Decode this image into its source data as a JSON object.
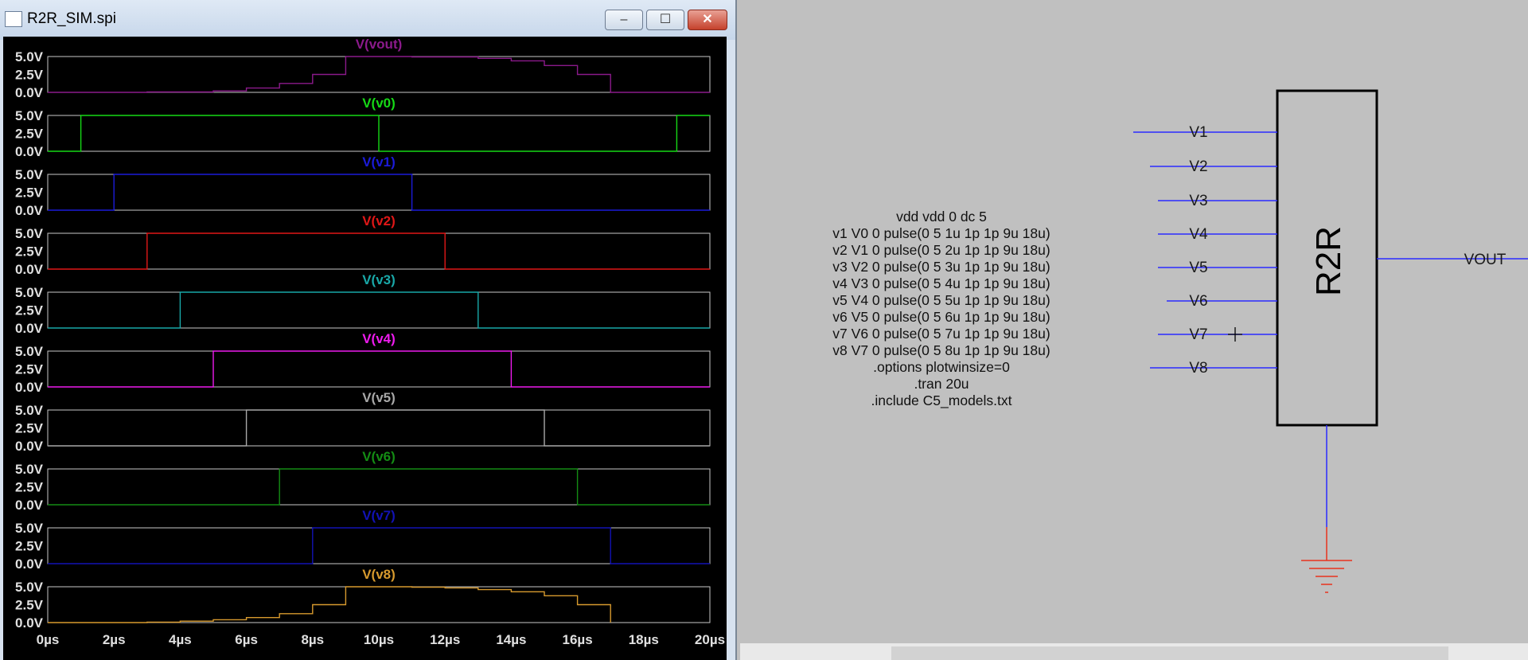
{
  "window": {
    "title": "R2R_SIM.spi",
    "buttons": {
      "minimize": "–",
      "maximize": "☐",
      "close": "✕"
    }
  },
  "colors": {
    "vout": "#8b1a8b",
    "v0": "#16d916",
    "v1": "#1b1bd9",
    "v2": "#e01717",
    "v3": "#19a8a8",
    "v4": "#ee1bee",
    "v5": "#a8a8a8",
    "v6": "#148c14",
    "v7": "#1212b4",
    "v8": "#d79a2e",
    "wire": "#2a2aff",
    "ground": "#e8321e"
  },
  "chart_data": {
    "type": "line",
    "xlabel": "",
    "x_ticks": [
      "0µs",
      "2µs",
      "4µs",
      "6µs",
      "8µs",
      "10µs",
      "12µs",
      "14µs",
      "16µs",
      "18µs",
      "20µs"
    ],
    "xlim": [
      0,
      20
    ],
    "y_ticks": [
      "5.0V",
      "2.5V",
      "0.0V"
    ],
    "ylim": [
      0,
      5
    ],
    "panels": [
      {
        "name": "V(vout)",
        "color_key": "vout",
        "points": [
          [
            0,
            0
          ],
          [
            3,
            0
          ],
          [
            3,
            0.05
          ],
          [
            5,
            0.05
          ],
          [
            5,
            0.2
          ],
          [
            6,
            0.2
          ],
          [
            6,
            0.6
          ],
          [
            7,
            0.6
          ],
          [
            7,
            1.25
          ],
          [
            8,
            1.25
          ],
          [
            8,
            2.5
          ],
          [
            9,
            2.5
          ],
          [
            9,
            5
          ],
          [
            11,
            5
          ],
          [
            11,
            4.95
          ],
          [
            13,
            4.95
          ],
          [
            13,
            4.75
          ],
          [
            14,
            4.75
          ],
          [
            14,
            4.4
          ],
          [
            15,
            4.4
          ],
          [
            15,
            3.75
          ],
          [
            16,
            3.75
          ],
          [
            16,
            2.5
          ],
          [
            17,
            2.5
          ],
          [
            17,
            0
          ],
          [
            20,
            0
          ]
        ]
      },
      {
        "name": "V(v0)",
        "color_key": "v0",
        "points": [
          [
            0,
            0
          ],
          [
            1,
            0
          ],
          [
            1,
            5
          ],
          [
            10,
            5
          ],
          [
            10,
            0
          ],
          [
            19,
            0
          ],
          [
            19,
            5
          ],
          [
            20,
            5
          ]
        ]
      },
      {
        "name": "V(v1)",
        "color_key": "v1",
        "points": [
          [
            0,
            0
          ],
          [
            2,
            0
          ],
          [
            2,
            5
          ],
          [
            11,
            5
          ],
          [
            11,
            0
          ],
          [
            20,
            0
          ]
        ]
      },
      {
        "name": "V(v2)",
        "color_key": "v2",
        "points": [
          [
            0,
            0
          ],
          [
            3,
            0
          ],
          [
            3,
            5
          ],
          [
            12,
            5
          ],
          [
            12,
            0
          ],
          [
            20,
            0
          ]
        ]
      },
      {
        "name": "V(v3)",
        "color_key": "v3",
        "points": [
          [
            0,
            0
          ],
          [
            4,
            0
          ],
          [
            4,
            5
          ],
          [
            13,
            5
          ],
          [
            13,
            0
          ],
          [
            20,
            0
          ]
        ]
      },
      {
        "name": "V(v4)",
        "color_key": "v4",
        "points": [
          [
            0,
            0
          ],
          [
            5,
            0
          ],
          [
            5,
            5
          ],
          [
            14,
            5
          ],
          [
            14,
            0
          ],
          [
            20,
            0
          ]
        ]
      },
      {
        "name": "V(v5)",
        "color_key": "v5",
        "points": [
          [
            0,
            0
          ],
          [
            6,
            0
          ],
          [
            6,
            5
          ],
          [
            15,
            5
          ],
          [
            15,
            0
          ],
          [
            20,
            0
          ]
        ]
      },
      {
        "name": "V(v6)",
        "color_key": "v6",
        "points": [
          [
            0,
            0
          ],
          [
            7,
            0
          ],
          [
            7,
            5
          ],
          [
            16,
            5
          ],
          [
            16,
            0
          ],
          [
            20,
            0
          ]
        ]
      },
      {
        "name": "V(v7)",
        "color_key": "v7",
        "points": [
          [
            0,
            0
          ],
          [
            8,
            0
          ],
          [
            8,
            5
          ],
          [
            17,
            5
          ],
          [
            17,
            0
          ],
          [
            20,
            0
          ]
        ]
      },
      {
        "name": "V(v8)",
        "color_key": "v8",
        "points": [
          [
            0,
            0
          ],
          [
            3,
            0
          ],
          [
            3,
            0.05
          ],
          [
            4,
            0.05
          ],
          [
            4,
            0.2
          ],
          [
            5,
            0.2
          ],
          [
            5,
            0.4
          ],
          [
            6,
            0.4
          ],
          [
            6,
            0.7
          ],
          [
            7,
            0.7
          ],
          [
            7,
            1.25
          ],
          [
            8,
            1.25
          ],
          [
            8,
            2.5
          ],
          [
            9,
            2.5
          ],
          [
            9,
            5
          ],
          [
            11,
            5
          ],
          [
            11,
            4.95
          ],
          [
            12,
            4.95
          ],
          [
            12,
            4.85
          ],
          [
            13,
            4.85
          ],
          [
            13,
            4.6
          ],
          [
            14,
            4.6
          ],
          [
            14,
            4.3
          ],
          [
            15,
            4.3
          ],
          [
            15,
            3.75
          ],
          [
            16,
            3.75
          ],
          [
            16,
            2.5
          ],
          [
            17,
            2.5
          ],
          [
            17,
            0
          ]
        ]
      }
    ]
  },
  "netlist": [
    "vdd vdd 0 dc 5",
    "v1 V0 0 pulse(0 5 1u 1p 1p 9u 18u)",
    "v2 V1 0 pulse(0 5 2u 1p 1p 9u 18u)",
    "v3 V2 0 pulse(0 5 3u 1p 1p 9u 18u)",
    "v4 V3 0 pulse(0 5 4u 1p 1p 9u 18u)",
    "v5 V4 0 pulse(0 5 5u 1p 1p 9u 18u)",
    "v6 V5 0 pulse(0 5 6u 1p 1p 9u 18u)",
    "v7 V6 0 pulse(0 5 7u 1p 1p 9u 18u)",
    "v8 V7 0 pulse(0 5 8u 1p 1p 9u 18u)",
    ".options plotwinsize=0",
    ".tran 20u",
    ".include C5_models.txt"
  ],
  "schematic": {
    "block_label": "R2R",
    "inputs": [
      "V1",
      "V2",
      "V3",
      "V4",
      "V5",
      "V6",
      "V7",
      "V8"
    ],
    "output": "VOUT"
  }
}
